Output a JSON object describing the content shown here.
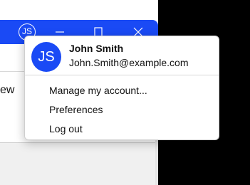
{
  "theme": {
    "accent": "#1a4af5",
    "desktop": "#000000",
    "popup_bg": "#ffffff",
    "content_bottom": "#f0f0f0"
  },
  "titlebar": {
    "avatar_initials": "JS",
    "buttons": [
      {
        "name": "minimize",
        "icon": "minimize-icon"
      },
      {
        "name": "maximize",
        "icon": "maximize-icon"
      },
      {
        "name": "close",
        "icon": "close-icon"
      }
    ]
  },
  "content": {
    "truncated_text": "ew"
  },
  "account_menu": {
    "avatar_initials": "JS",
    "user_name": "John Smith",
    "user_email": "John.Smith@example.com",
    "items": [
      {
        "label": "Manage my account..."
      },
      {
        "label": "Preferences"
      },
      {
        "label": "Log out"
      }
    ]
  }
}
